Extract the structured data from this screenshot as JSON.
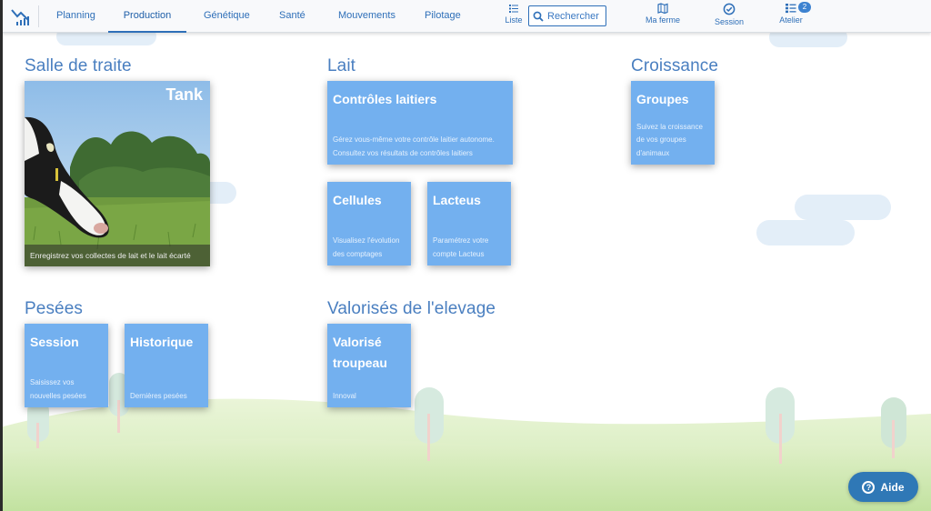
{
  "nav": {
    "tabs": [
      {
        "label": "Planning"
      },
      {
        "label": "Production",
        "active": true
      },
      {
        "label": "Génétique"
      },
      {
        "label": "Santé"
      },
      {
        "label": "Mouvements"
      },
      {
        "label": "Pilotage"
      }
    ],
    "liste_label": "Liste",
    "search_placeholder": "Rechercher",
    "ma_ferme_label": "Ma ferme",
    "session_label": "Session",
    "atelier_label": "Atelier",
    "atelier_badge": "2"
  },
  "sections": {
    "salle_de_traite": {
      "title": "Salle de traite",
      "tank": {
        "title": "Tank",
        "desc": "Enregistrez vos collectes de lait et le lait écarté"
      }
    },
    "lait": {
      "title": "Lait",
      "controles": {
        "title": "Contrôles laitiers",
        "desc": "Gérez vous-même votre contrôle laitier autonome. Consultez vos résultats de contrôles laitiers"
      },
      "cellules": {
        "title": "Cellules",
        "desc": "Visualisez l'évolution des comptages"
      },
      "lacteus": {
        "title": "Lacteus",
        "desc": "Paramétrez votre compte Lacteus"
      }
    },
    "croissance": {
      "title": "Croissance",
      "groupes": {
        "title": "Groupes",
        "desc": "Suivez la croissance de vos groupes d'animaux"
      }
    },
    "pesees": {
      "title": "Pesées",
      "session": {
        "title": "Session",
        "desc": "Saisissez vos nouvelles pesées"
      },
      "historique": {
        "title": "Historique",
        "desc": "Dernières pesées"
      }
    },
    "valorises": {
      "title": "Valorisés de l'elevage",
      "troupeau": {
        "title": "Valorisé troupeau",
        "desc": "Innoval"
      }
    }
  },
  "help_label": "Aide",
  "colors": {
    "accent": "#2e6fb8",
    "card": "#73b0ef",
    "section_title": "#4a7fc0",
    "help_button": "#2f78b6"
  }
}
